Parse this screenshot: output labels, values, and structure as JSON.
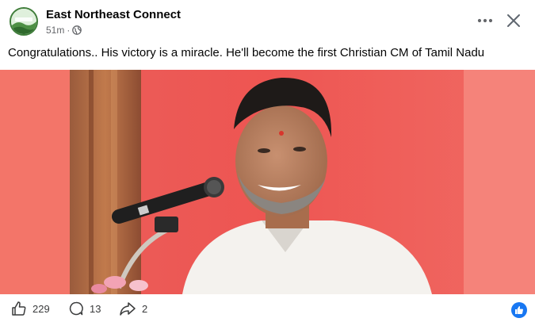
{
  "post": {
    "author": "East Northeast Connect",
    "time": "51m",
    "separator": "·",
    "caption": "Congratulations.. His victory is a miracle. He'll become the first Christian CM of Tamil Nadu"
  },
  "header": {
    "more_icon": "more-horizontal-icon",
    "close_icon": "close-icon",
    "avatar_text": "East Northeast Connect"
  },
  "stats": {
    "likes": "229",
    "comments": "13",
    "shares": "2"
  },
  "colors": {
    "accent": "#1877f2",
    "photo_background": "#e8534f"
  }
}
